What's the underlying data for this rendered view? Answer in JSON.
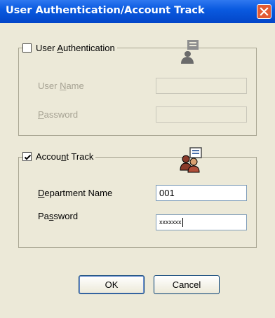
{
  "window": {
    "title": "User Authentication/Account Track"
  },
  "user_auth": {
    "label_pre": "User ",
    "label_key": "A",
    "label_post": "uthentication",
    "checked": false,
    "icon": "user-card-icon",
    "username_label_pre": "User ",
    "username_label_key": "N",
    "username_label_post": "ame",
    "username_value": "",
    "password_label_key": "P",
    "password_label_post": "assword",
    "password_value": ""
  },
  "account_track": {
    "label_pre": "Accou",
    "label_key": "n",
    "label_post": "t Track",
    "checked": true,
    "icon": "users-card-icon",
    "department_label_key": "D",
    "department_label_post": "epartment Name",
    "department_value": "001",
    "password_label_pre": "Pa",
    "password_label_key": "s",
    "password_label_post": "sword",
    "password_value": "xxxxxxx"
  },
  "buttons": {
    "ok": "OK",
    "cancel": "Cancel"
  },
  "colors": {
    "title_bar": "#0a5ae0",
    "close_button": "#e35a33",
    "dialog_bg": "#ece9d8"
  }
}
